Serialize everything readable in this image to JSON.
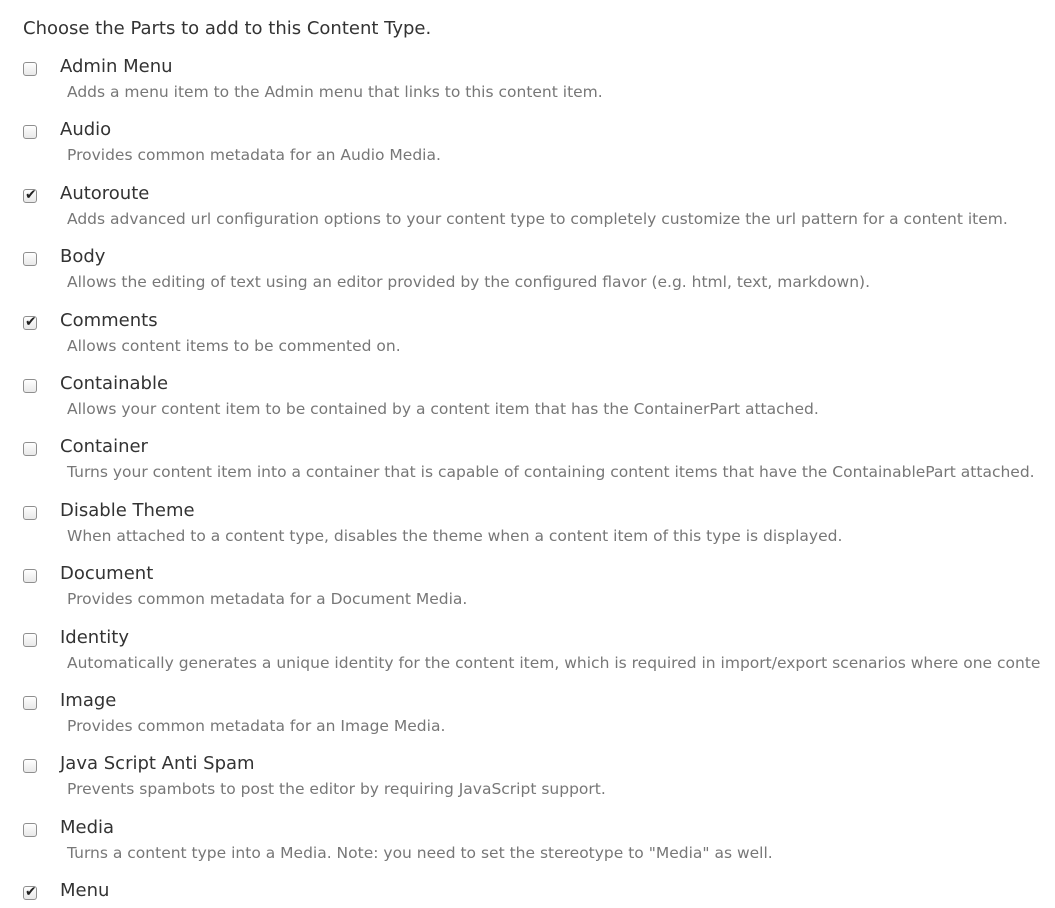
{
  "prompt": "Choose the Parts to add to this Content Type.",
  "parts": [
    {
      "name": "Admin Menu",
      "description": "Adds a menu item to the Admin menu that links to this content item.",
      "checked": false
    },
    {
      "name": "Audio",
      "description": "Provides common metadata for an Audio Media.",
      "checked": false
    },
    {
      "name": "Autoroute",
      "description": "Adds advanced url configuration options to your content type to completely customize the url pattern for a content item.",
      "checked": true
    },
    {
      "name": "Body",
      "description": "Allows the editing of text using an editor provided by the configured flavor (e.g. html, text, markdown).",
      "checked": false
    },
    {
      "name": "Comments",
      "description": "Allows content items to be commented on.",
      "checked": true
    },
    {
      "name": "Containable",
      "description": "Allows your content item to be contained by a content item that has the ContainerPart attached.",
      "checked": false
    },
    {
      "name": "Container",
      "description": "Turns your content item into a container that is capable of containing content items that have the ContainablePart attached.",
      "checked": false
    },
    {
      "name": "Disable Theme",
      "description": "When attached to a content type, disables the theme when a content item of this type is displayed.",
      "checked": false
    },
    {
      "name": "Document",
      "description": "Provides common metadata for a Document Media.",
      "checked": false
    },
    {
      "name": "Identity",
      "description": "Automatically generates a unique identity for the content item, which is required in import/export scenarios where one conte",
      "checked": false
    },
    {
      "name": "Image",
      "description": "Provides common metadata for an Image Media.",
      "checked": false
    },
    {
      "name": "Java Script Anti Spam",
      "description": "Prevents spambots to post the editor by requiring JavaScript support.",
      "checked": false
    },
    {
      "name": "Media",
      "description": "Turns a content type into a Media. Note: you need to set the stereotype to \"Media\" as well.",
      "checked": false
    },
    {
      "name": "Menu",
      "description": "",
      "checked": true
    }
  ]
}
